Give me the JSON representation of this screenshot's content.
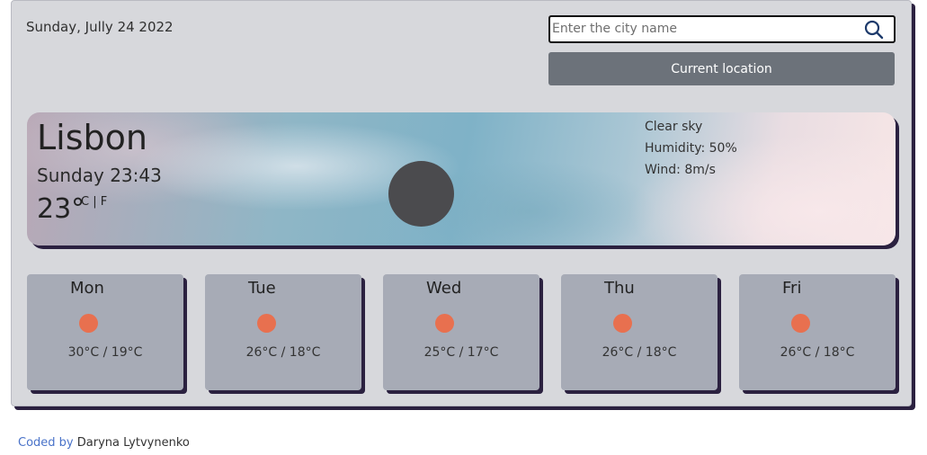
{
  "header": {
    "date": "Sunday, Jully 24 2022"
  },
  "search": {
    "placeholder": "Enter the city name",
    "value": "",
    "current_location_label": "Current location"
  },
  "current": {
    "city": "Lisbon",
    "day_time": "Sunday 23:43",
    "temp": "23°",
    "unit_c": "C",
    "unit_sep": "|",
    "unit_f": "F",
    "description": "Clear sky",
    "humidity": "Humidity: 50%",
    "wind": "Wind: 8m/s",
    "icon": "moon-icon",
    "icon_color": "#4b4b4e"
  },
  "forecast": [
    {
      "day": "Mon",
      "temps": "30°C / 19°C",
      "icon": "sun-icon"
    },
    {
      "day": "Tue",
      "temps": "26°C / 18°C",
      "icon": "sun-icon"
    },
    {
      "day": "Wed",
      "temps": "25°C / 17°C",
      "icon": "sun-icon"
    },
    {
      "day": "Thu",
      "temps": "26°C / 18°C",
      "icon": "sun-icon"
    },
    {
      "day": "Fri",
      "temps": "26°C / 18°C",
      "icon": "sun-icon"
    }
  ],
  "footer": {
    "link_text": "Coded by",
    "author": "Daryna Lytvynenko"
  },
  "colors": {
    "sun": "#e8704f",
    "button": "#6c727a",
    "card": "#a7abb6",
    "link": "#4a73c9",
    "shadow": "#2b2140"
  }
}
